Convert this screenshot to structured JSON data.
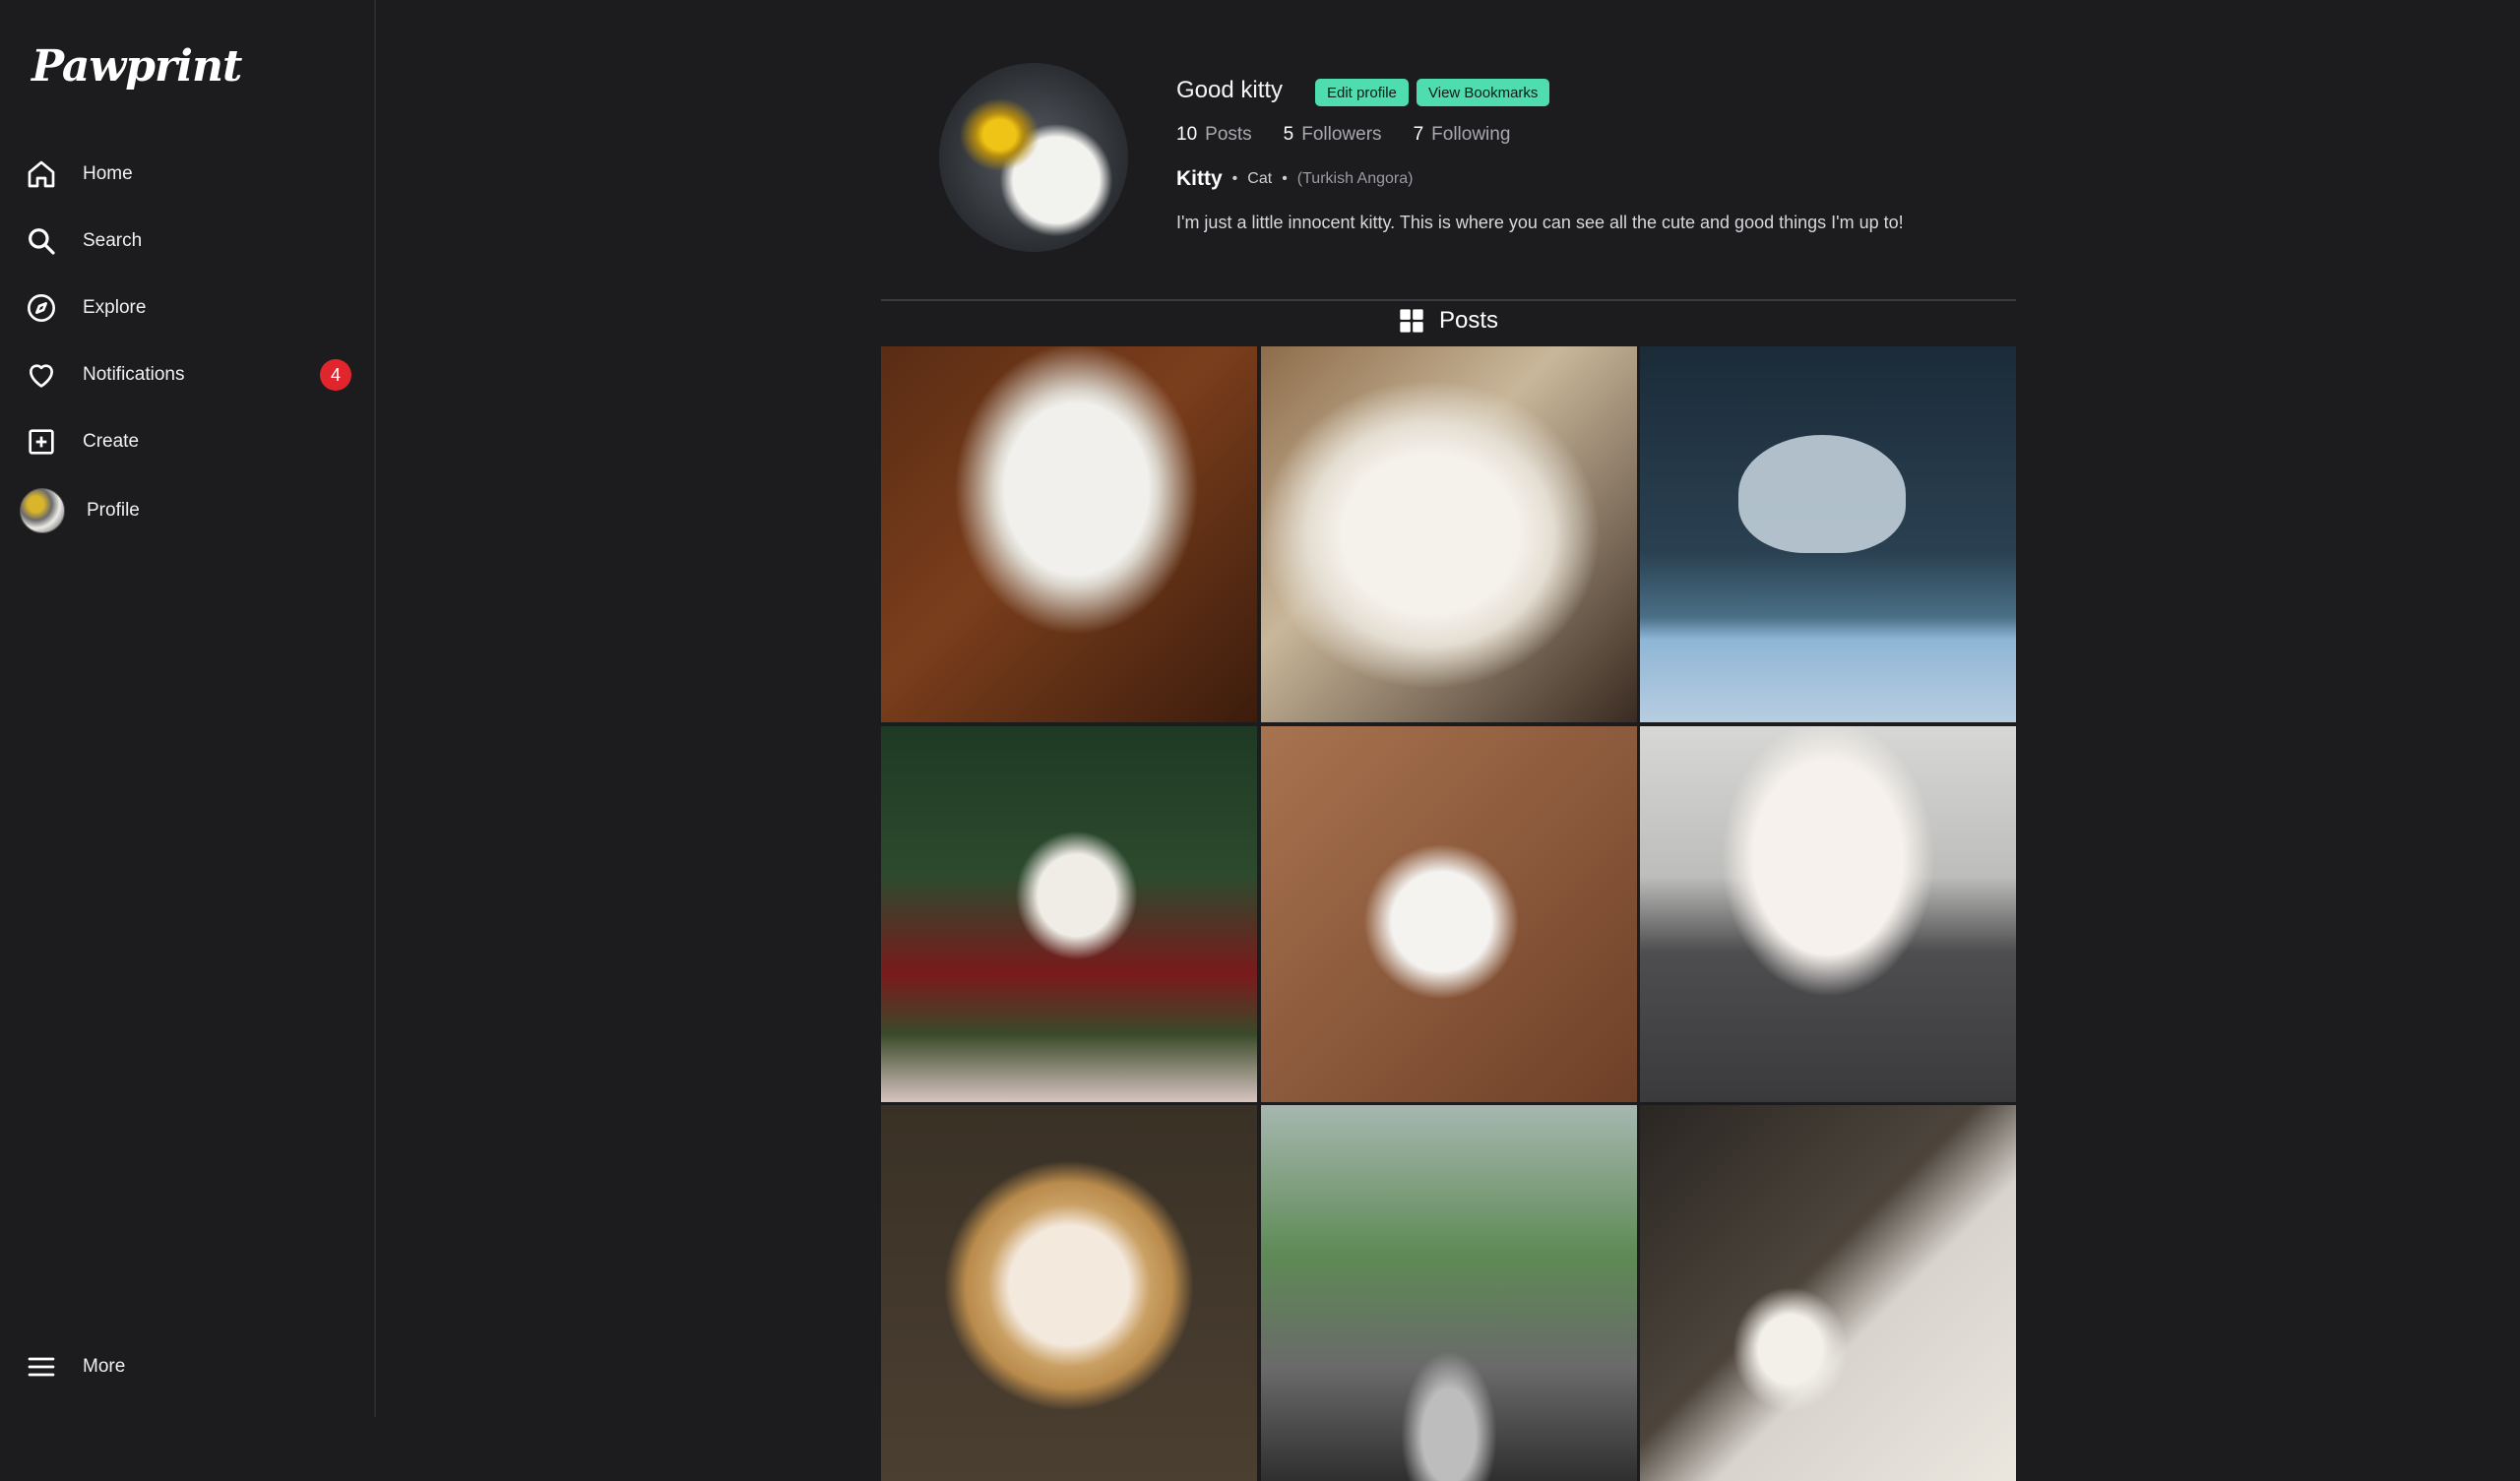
{
  "app": {
    "logo": "Pawprint"
  },
  "sidebar": {
    "items": [
      {
        "label": "Home",
        "icon": "home-icon"
      },
      {
        "label": "Search",
        "icon": "search-icon"
      },
      {
        "label": "Explore",
        "icon": "compass-icon"
      },
      {
        "label": "Notifications",
        "icon": "heart-icon",
        "badge": "4"
      },
      {
        "label": "Create",
        "icon": "plus-square-icon"
      },
      {
        "label": "Profile",
        "icon": "avatar"
      }
    ],
    "more": {
      "label": "More",
      "icon": "menu-icon"
    }
  },
  "profile": {
    "username": "Good kitty",
    "edit_label": "Edit profile",
    "bookmarks_label": "View Bookmarks",
    "stats": [
      {
        "num": "10",
        "label": "Posts"
      },
      {
        "num": "5",
        "label": "Followers"
      },
      {
        "num": "7",
        "label": "Following"
      }
    ],
    "name": "Kitty",
    "species": "Cat",
    "breed": "(Turkish Angora)",
    "bio": "I'm just a little innocent kitty. This is where you can see all the cute and good things I'm up to!"
  },
  "posts_tab": {
    "label": "Posts",
    "icon": "grid-icon"
  },
  "colors": {
    "accent": "#4fdcae",
    "badge": "#e0262c",
    "background": "#1c1c1f"
  },
  "posts": [
    {
      "id": "post-1"
    },
    {
      "id": "post-2"
    },
    {
      "id": "post-3"
    },
    {
      "id": "post-4"
    },
    {
      "id": "post-5"
    },
    {
      "id": "post-6"
    },
    {
      "id": "post-7"
    },
    {
      "id": "post-8"
    },
    {
      "id": "post-9"
    }
  ]
}
